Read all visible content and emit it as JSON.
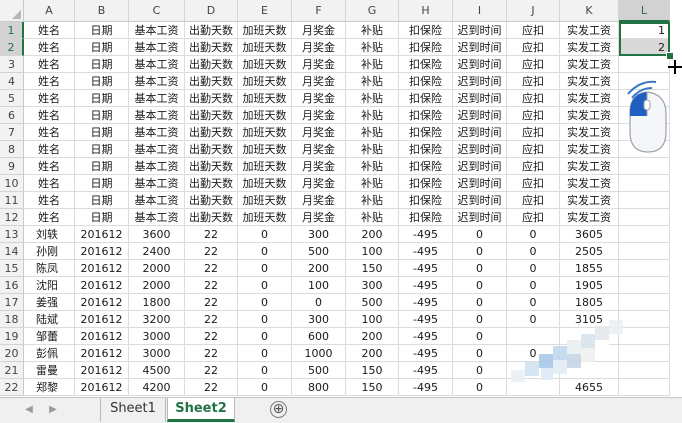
{
  "columns": [
    "A",
    "B",
    "C",
    "D",
    "E",
    "F",
    "G",
    "H",
    "I",
    "J",
    "K",
    "L"
  ],
  "selected_column": "L",
  "header_row": [
    "姓名",
    "日期",
    "基本工资",
    "出勤天数",
    "加班天数",
    "月奖金",
    "补贴",
    "扣保险",
    "迟到时间",
    "应扣",
    "实发工资"
  ],
  "header_rows_count": 12,
  "selection_values": [
    "1",
    "2"
  ],
  "data_rows": [
    [
      "刘轶",
      "201612",
      "3600",
      "22",
      "0",
      "300",
      "200",
      "-495",
      "0",
      "0",
      "3605"
    ],
    [
      "孙刚",
      "201612",
      "2400",
      "22",
      "0",
      "500",
      "100",
      "-495",
      "0",
      "0",
      "2505"
    ],
    [
      "陈凤",
      "201612",
      "2000",
      "22",
      "0",
      "200",
      "150",
      "-495",
      "0",
      "0",
      "1855"
    ],
    [
      "沈阳",
      "201612",
      "2000",
      "22",
      "0",
      "100",
      "300",
      "-495",
      "0",
      "0",
      "1905"
    ],
    [
      "姜强",
      "201612",
      "1800",
      "22",
      "0",
      "0",
      "500",
      "-495",
      "0",
      "0",
      "1805"
    ],
    [
      "陆斌",
      "201612",
      "3200",
      "22",
      "0",
      "300",
      "100",
      "-495",
      "0",
      "0",
      "3105"
    ],
    [
      "邹蕾",
      "201612",
      "3000",
      "22",
      "0",
      "600",
      "200",
      "-495",
      "0",
      "",
      ""
    ],
    [
      "彭佩",
      "201612",
      "3000",
      "22",
      "0",
      "1000",
      "200",
      "-495",
      "0",
      "0",
      ""
    ],
    [
      "雷曼",
      "201612",
      "4500",
      "22",
      "0",
      "500",
      "150",
      "-495",
      "0",
      "",
      ""
    ],
    [
      "郑黎",
      "201612",
      "4200",
      "22",
      "0",
      "800",
      "150",
      "-495",
      "0",
      "",
      "4655"
    ]
  ],
  "row_numbers": [
    "1",
    "2",
    "3",
    "4",
    "5",
    "6",
    "7",
    "8",
    "9",
    "10",
    "11",
    "12",
    "13",
    "14",
    "15",
    "16",
    "17",
    "18",
    "19",
    "20",
    "21",
    "22"
  ],
  "tabs": [
    {
      "label": "Sheet1",
      "active": false
    },
    {
      "label": "Sheet2",
      "active": true
    }
  ],
  "add_sheet_label": "⊕",
  "nav_prev": "◀",
  "nav_next": "▶",
  "accent_color": "#217346",
  "icons": [
    "fill-handle-icon",
    "crosshair-cursor-icon",
    "mouse-icon",
    "add-sheet-icon"
  ]
}
